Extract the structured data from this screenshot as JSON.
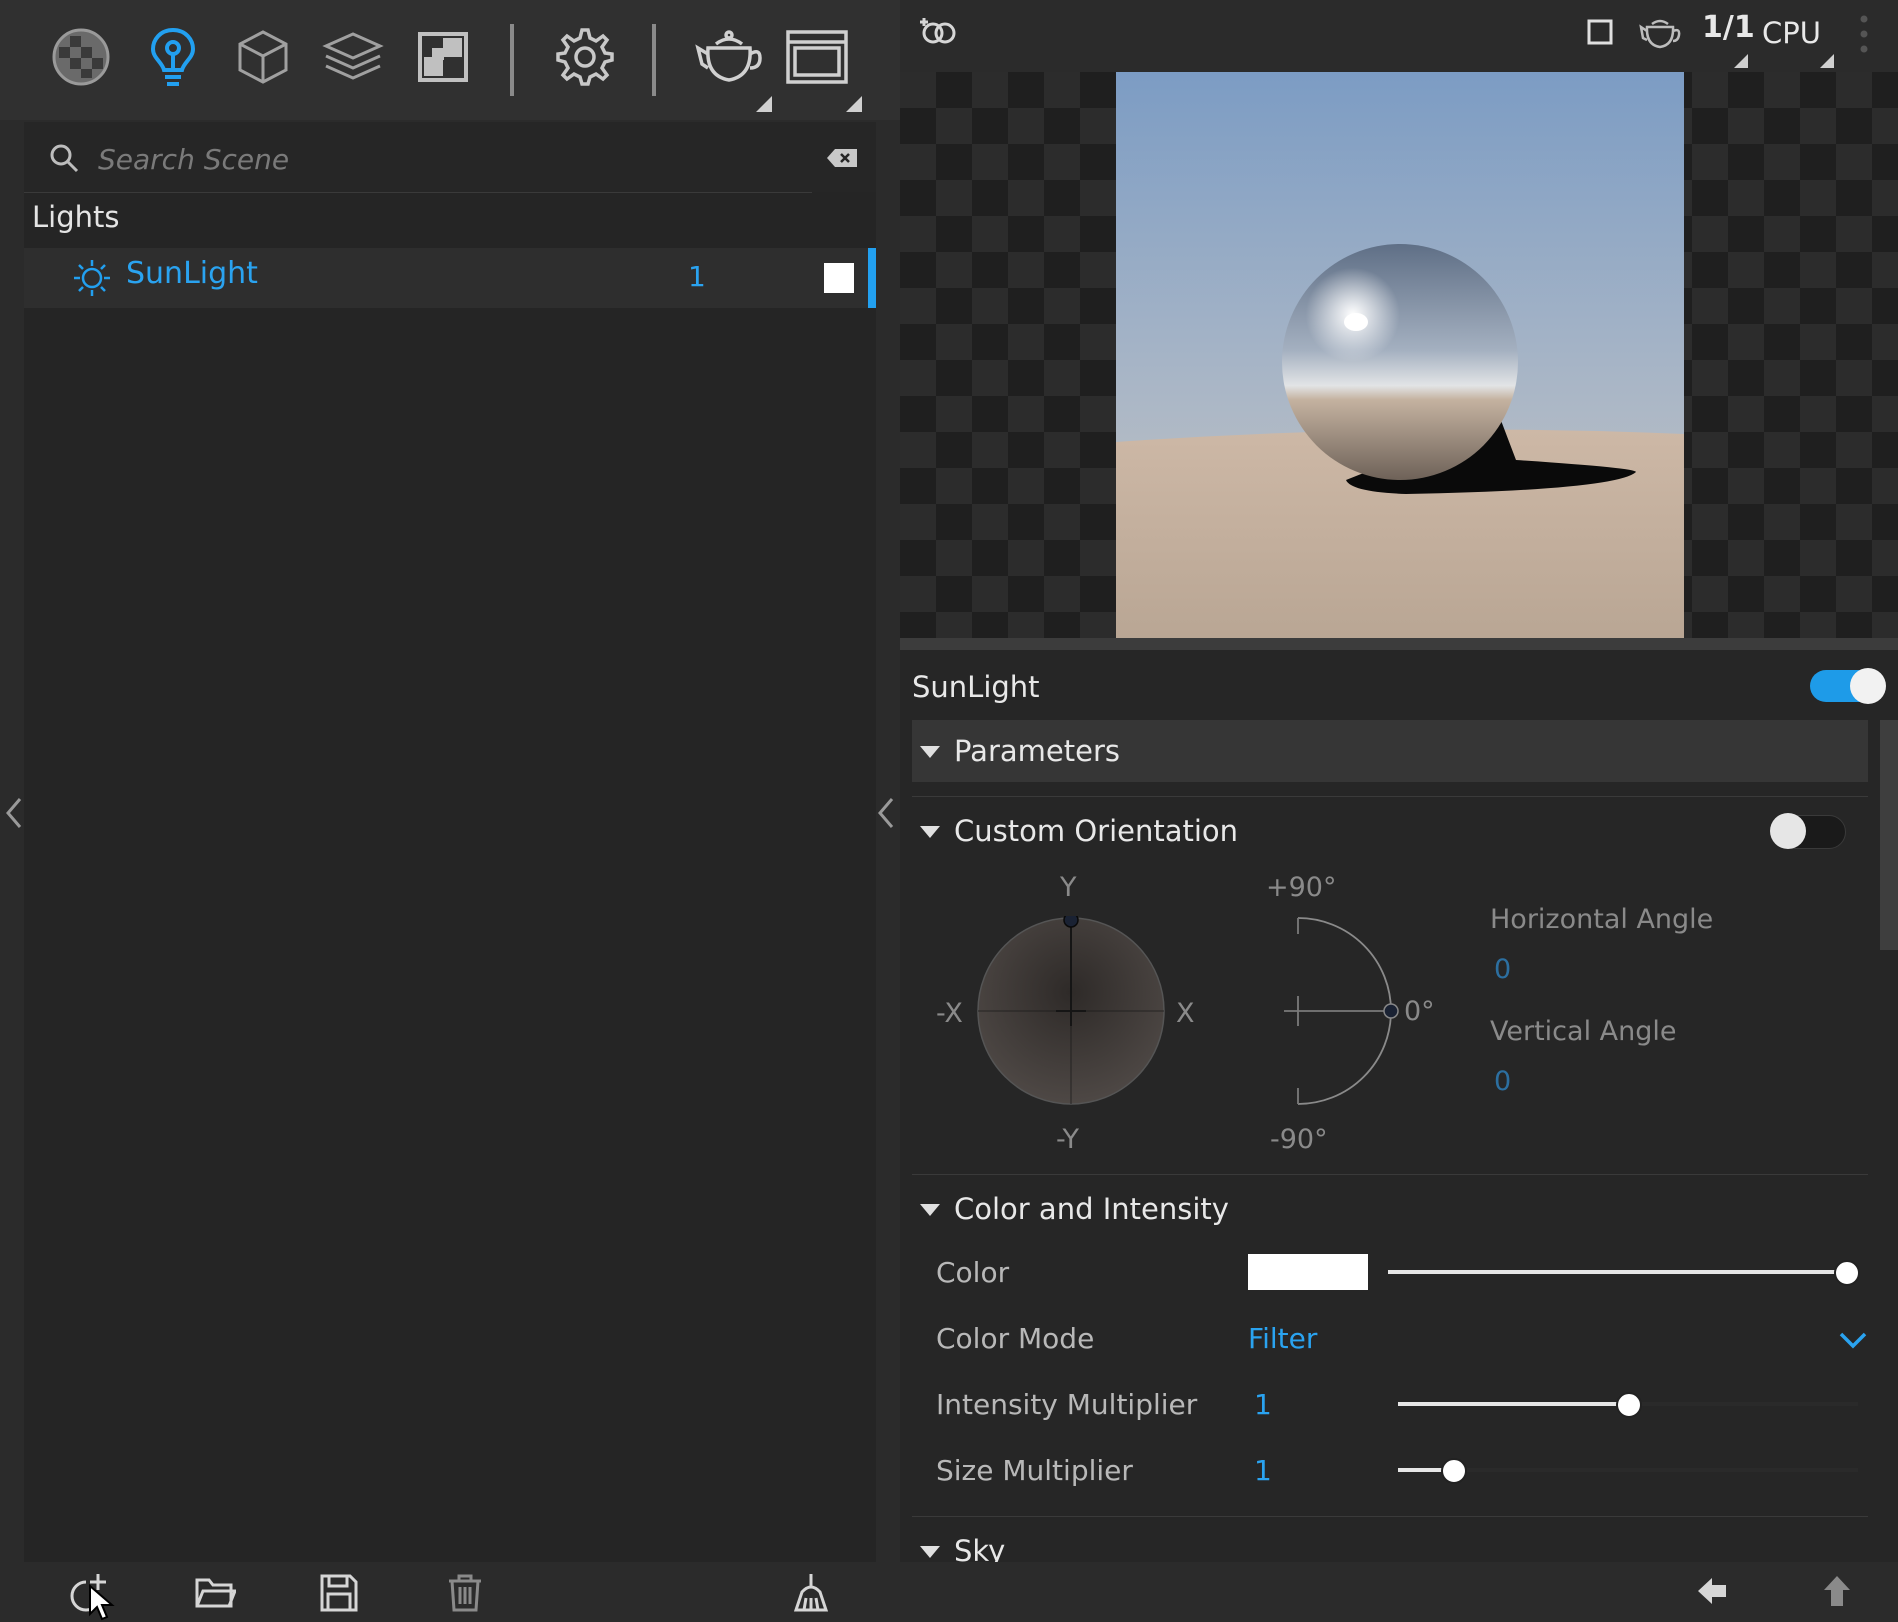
{
  "scene": {
    "search_placeholder": "Search Scene",
    "group_label": "Lights",
    "items": [
      {
        "label": "SunLight",
        "value": "1",
        "swatch_color": "#ffffff",
        "selected": true
      }
    ]
  },
  "viewport": {
    "ratio_label": "1/1",
    "device_label": "CPU"
  },
  "properties": {
    "title": "SunLight",
    "enabled": true,
    "parameters_label": "Parameters",
    "custom_orientation": {
      "label": "Custom Orientation",
      "enabled": false,
      "axis_labels": {
        "pos_y": "Y",
        "neg_y": "-Y",
        "pos_x": "X",
        "neg_x": "-X"
      },
      "arc_labels": {
        "top": "+90°",
        "middle": "0°",
        "bottom": "-90°"
      },
      "horizontal_angle_label": "Horizontal Angle",
      "horizontal_angle_value": "0",
      "vertical_angle_label": "Vertical Angle",
      "vertical_angle_value": "0"
    },
    "color_intensity": {
      "label": "Color and Intensity",
      "color_label": "Color",
      "color_value": "#ffffff",
      "color_slider_level": 1.0,
      "color_mode_label": "Color Mode",
      "color_mode_value": "Filter",
      "intensity_label": "Intensity Multiplier",
      "intensity_value": "1",
      "intensity_slider_level": 0.5,
      "size_label": "Size Multiplier",
      "size_value": "1",
      "size_slider_level": 0.12
    },
    "sky_label": "Sky"
  },
  "colors": {
    "accent": "#22a0f0",
    "panel": "#252525",
    "toolbar": "#303030"
  },
  "icons": {
    "toolbar": [
      "materials-icon",
      "lights-icon",
      "objects-icon",
      "layers-icon",
      "textures-icon",
      "settings-icon",
      "teapot-icon",
      "render-window-icon"
    ],
    "bottom": [
      "add-light-icon",
      "open-folder-icon",
      "save-icon",
      "delete-icon",
      "clear-scene-icon",
      "back-icon",
      "upload-icon"
    ]
  }
}
